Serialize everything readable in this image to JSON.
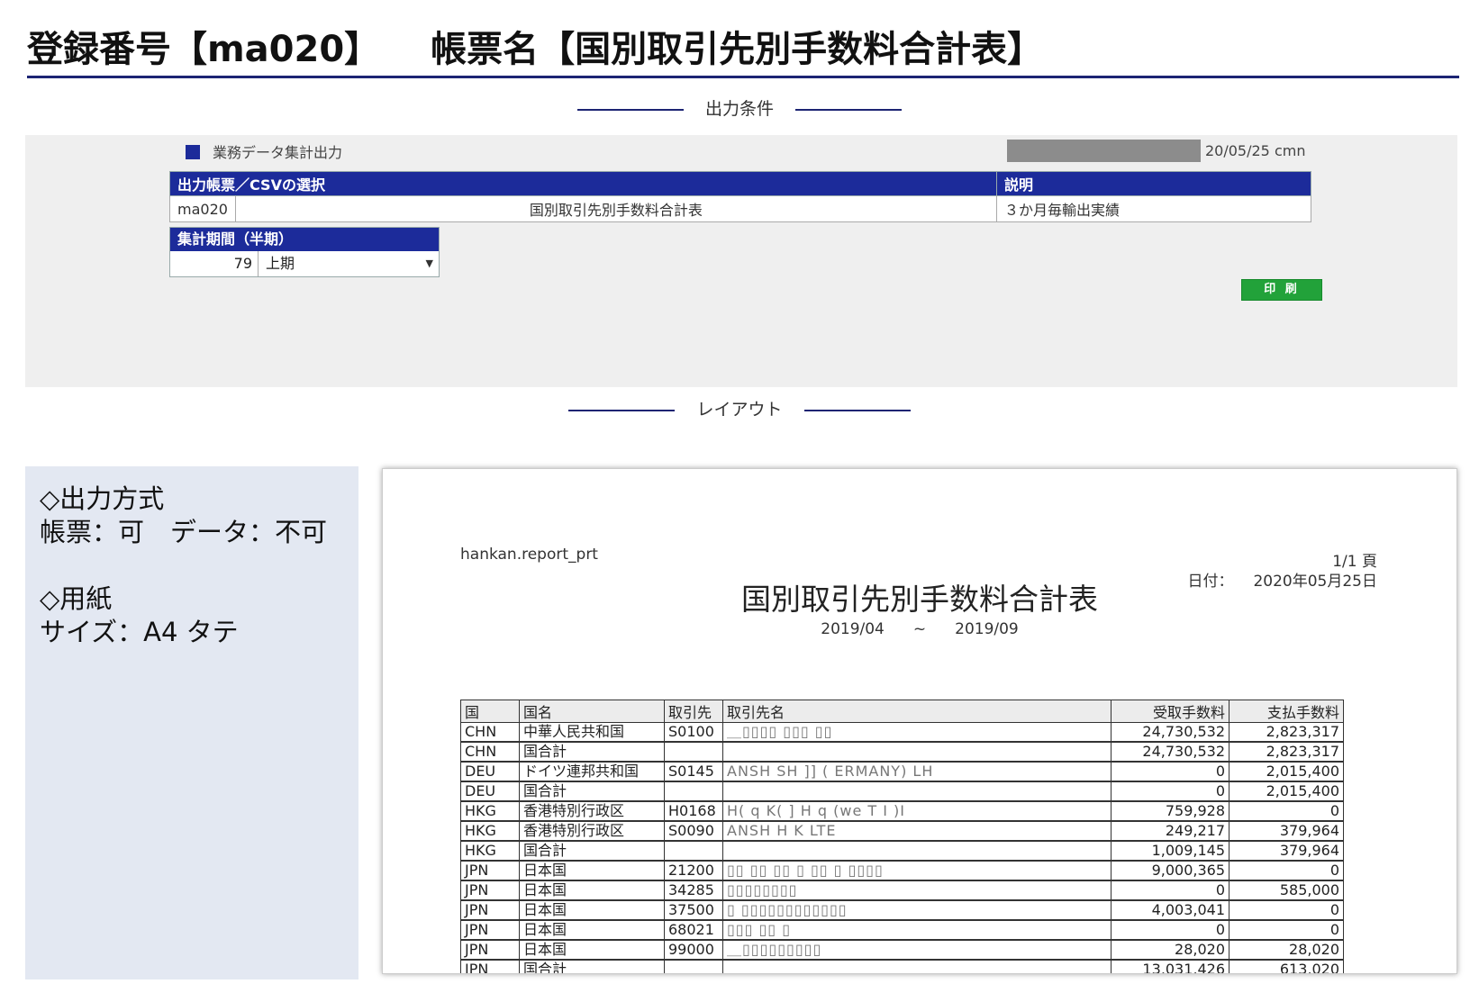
{
  "header": {
    "reg_no": "登録番号【ma020】",
    "report_name": "帳票名【国別取引先別手数料合計表】"
  },
  "sections": {
    "conditions": "出力条件",
    "layout": "レイアウト"
  },
  "conditions": {
    "system_name": "業務データ集計出力",
    "stamp": "20/05/25 cmn",
    "table_headers": [
      "出力帳票／CSVの選択",
      "説明"
    ],
    "selected_code": "ma020",
    "selected_name": "国別取引先別手数料合計表",
    "description": "３か月毎輸出実績",
    "period_header": "集計期間（半期）",
    "period_number": "79",
    "period_select": "上期",
    "print_button": "印 刷"
  },
  "info": {
    "output_method_title": "◇出力方式",
    "output_method_value": "帳票：可　データ：不可",
    "paper_title": "◇用紙",
    "paper_value": "サイズ：A4 タテ"
  },
  "report": {
    "program": "hankan.report_prt",
    "page": "1/1 頁",
    "date_label": "日付：",
    "date_value": "2020年05月25日",
    "title": "国別取引先別手数料合計表",
    "range_from": "2019/04",
    "range_sep": "~",
    "range_to": "2019/09",
    "columns": [
      "国",
      "国名",
      "取引先",
      "取引先名",
      "受取手数料",
      "支払手数料"
    ],
    "rows": [
      {
        "c": "CHN",
        "n": "中華人民共和国",
        "id": "S0100",
        "name": "＿▯▯▯▯ ▯▯▯ ▯▯",
        "r": "24,730,532",
        "p": "2,823,317"
      },
      {
        "c": "CHN",
        "n": "国合計",
        "id": "",
        "name": "",
        "r": "24,730,532",
        "p": "2,823,317"
      },
      {
        "c": "DEU",
        "n": "ドイツ連邦共和国",
        "id": "S0145",
        "name": " ANSH   SH  ]]  ( ERMANY)   LH",
        "r": "0",
        "p": "2,015,400"
      },
      {
        "c": "DEU",
        "n": "国合計",
        "id": "",
        "name": "",
        "r": "0",
        "p": "2,015,400"
      },
      {
        "c": "HKG",
        "n": "香港特別行政区",
        "id": "H0168",
        "name": "H(  q  K(  ]  H  q  (we   T   I  )I",
        "r": "759,928",
        "p": "0"
      },
      {
        "c": "HKG",
        "n": "香港特別行政区",
        "id": "S0090",
        "name": " ANSH    H  K          LTE",
        "r": "249,217",
        "p": "379,964"
      },
      {
        "c": "HKG",
        "n": "国合計",
        "id": "",
        "name": "",
        "r": "1,009,145",
        "p": "379,964"
      },
      {
        "c": "JPN",
        "n": "日本国",
        "id": "21200",
        "name": "▯▯ ▯▯ ▯▯  ▯ ▯▯ ▯  ▯▯▯▯",
        "r": "9,000,365",
        "p": "0"
      },
      {
        "c": "JPN",
        "n": "日本国",
        "id": "34285",
        "name": "▯▯▯▯▯▯▯▯",
        "r": "0",
        "p": "585,000"
      },
      {
        "c": "JPN",
        "n": "日本国",
        "id": "37500",
        "name": "▯ ▯▯▯▯▯▯▯▯▯▯▯▯",
        "r": "4,003,041",
        "p": "0"
      },
      {
        "c": "JPN",
        "n": "日本国",
        "id": "68021",
        "name": "▯▯▯ ▯▯  ▯",
        "r": "0",
        "p": "0"
      },
      {
        "c": "JPN",
        "n": "日本国",
        "id": "99000",
        "name": "＿▯▯▯▯▯▯▯▯▯",
        "r": "28,020",
        "p": "28,020"
      },
      {
        "c": "JPN",
        "n": "国合計",
        "id": "",
        "name": "",
        "r": "13,031,426",
        "p": "613,020"
      }
    ]
  }
}
